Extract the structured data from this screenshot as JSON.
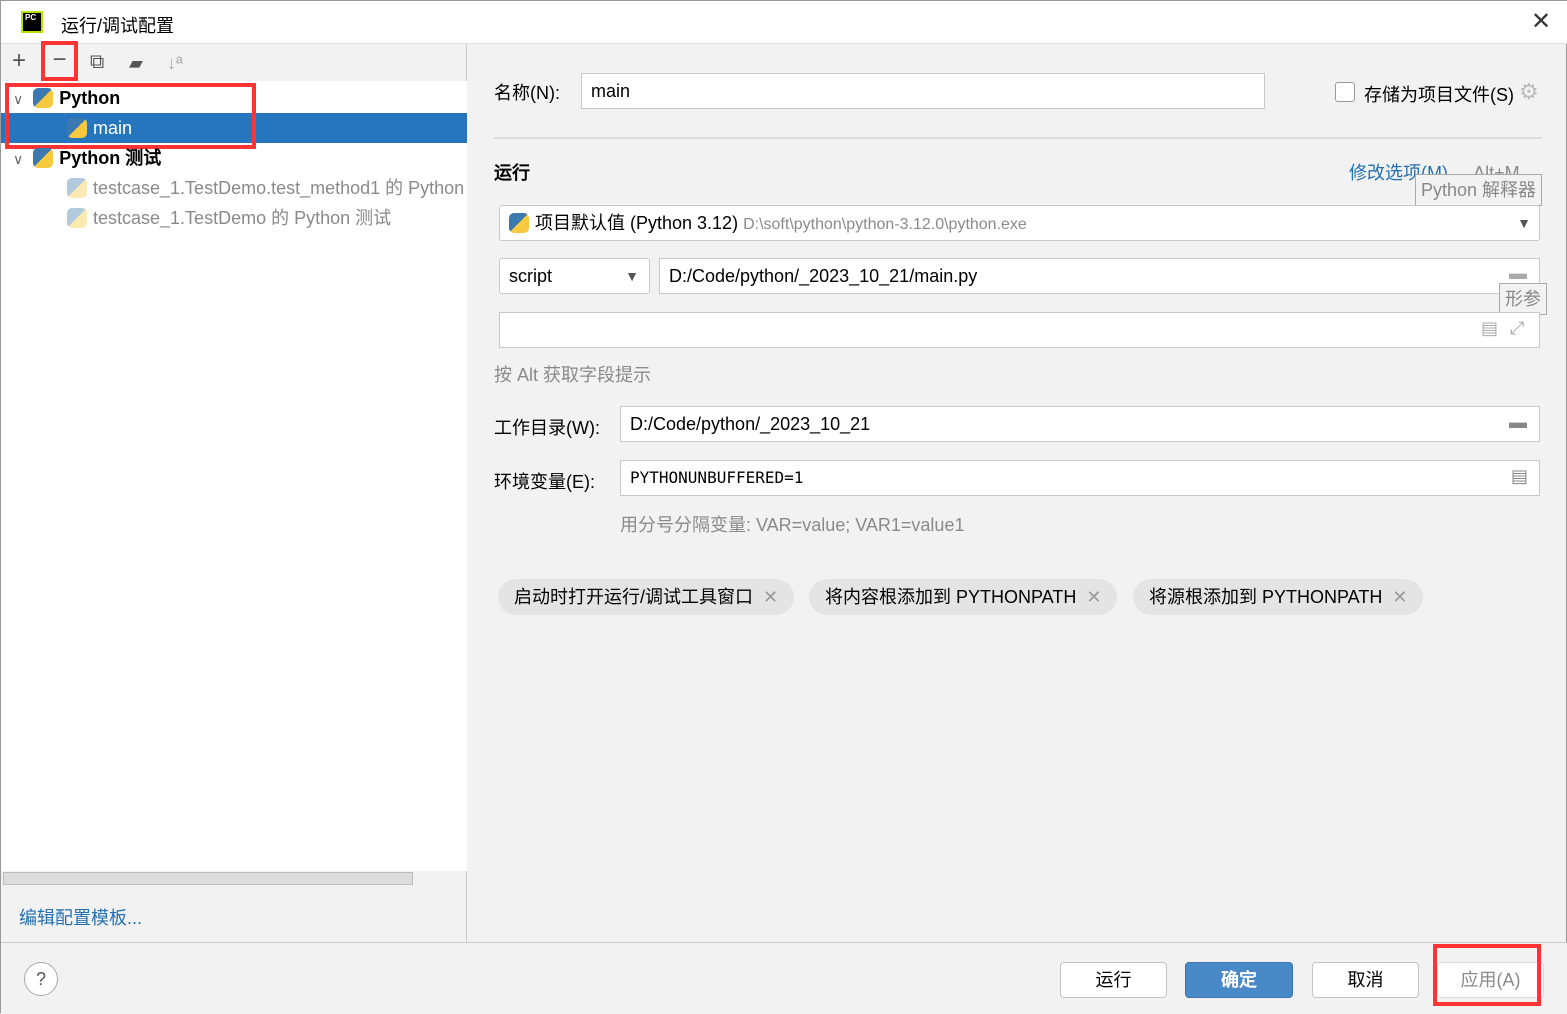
{
  "window": {
    "title": "运行/调试配置",
    "close": "✕",
    "logo": "PC"
  },
  "toolbar": {
    "add": "+",
    "remove": "−",
    "copy": "⧉",
    "folder": "▰",
    "sort": "↓ª"
  },
  "tree": {
    "groups": [
      {
        "label": "Python",
        "children": [
          {
            "label": "main",
            "selected": true
          }
        ]
      },
      {
        "label": "Python 测试",
        "children": [
          {
            "label": "testcase_1.TestDemo.test_method1 的 Python 测试"
          },
          {
            "label": "testcase_1.TestDemo 的 Python 测试"
          }
        ]
      }
    ]
  },
  "edit_templates": "编辑配置模板...",
  "form": {
    "name_label": "名称(N):",
    "name_value": "main",
    "store_label": "存储为项目文件(S)",
    "store_checked": false,
    "section_run": "运行",
    "modify_options": "修改选项(M)",
    "modify_shortcut": "Alt+M",
    "interpreter_tooltip": "Python 解释器",
    "interpreter": "项目默认值 (Python 3.12)",
    "interpreter_path": "D:\\soft\\python\\python-3.12.0\\python.exe",
    "script_type": "script",
    "script_path": "D:/Code/python/_2023_10_21/main.py",
    "params_tooltip": "形参",
    "params_value": "",
    "alt_hint": "按 Alt 获取字段提示",
    "workdir_label": "工作目录(W):",
    "workdir_value": "D:/Code/python/_2023_10_21",
    "env_label": "环境变量(E):",
    "env_value": "PYTHONUNBUFFERED=1",
    "env_hint": "用分号分隔变量: VAR=value; VAR1=value1",
    "chips": [
      "启动时打开运行/调试工具窗口",
      "将内容根添加到 PYTHONPATH",
      "将源根添加到 PYTHONPATH"
    ]
  },
  "buttons": {
    "help": "?",
    "run": "运行",
    "ok": "确定",
    "cancel": "取消",
    "apply": "应用(A)"
  },
  "colors": {
    "selection": "#2675bf",
    "primary": "#4a89c8",
    "highlight": "#ff3333",
    "link": "#2470b3"
  }
}
